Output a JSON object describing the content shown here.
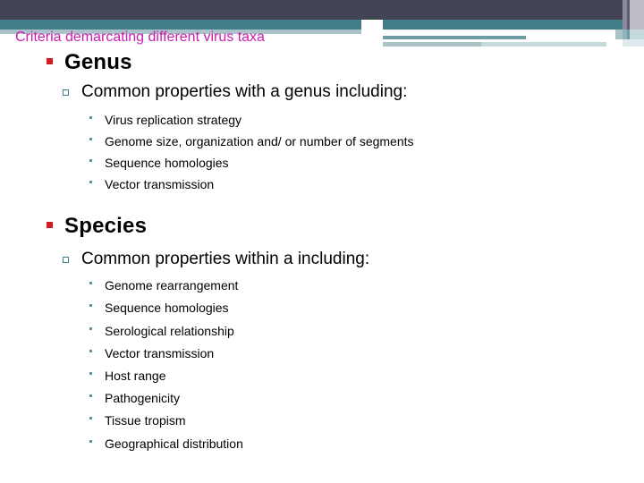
{
  "slide": {
    "title": "Criteria demarcating different virus taxa",
    "title_color": "#cc1cb0",
    "background_color": "#ffffff"
  },
  "theme": {
    "dark_band_color": "#434356",
    "teal_band_color": "#427e89",
    "pale_band_color": "#a9c3c8",
    "bullet_red": "#d71920",
    "bullet_teal": "#3f7f8c"
  },
  "sections": [
    {
      "heading": "Genus",
      "subheading": "Common properties with a genus including:",
      "items": [
        "Virus replication strategy",
        "Genome size, organization and/ or number of segments",
        "Sequence homologies",
        "Vector transmission"
      ]
    },
    {
      "heading": "Species",
      "subheading": "Common properties within a including:",
      "items": [
        "Genome rearrangement",
        "Sequence homologies",
        "Serological relationship",
        "Vector transmission",
        "Host range",
        "Pathogenicity",
        "Tissue tropism",
        "Geographical distribution"
      ]
    }
  ]
}
